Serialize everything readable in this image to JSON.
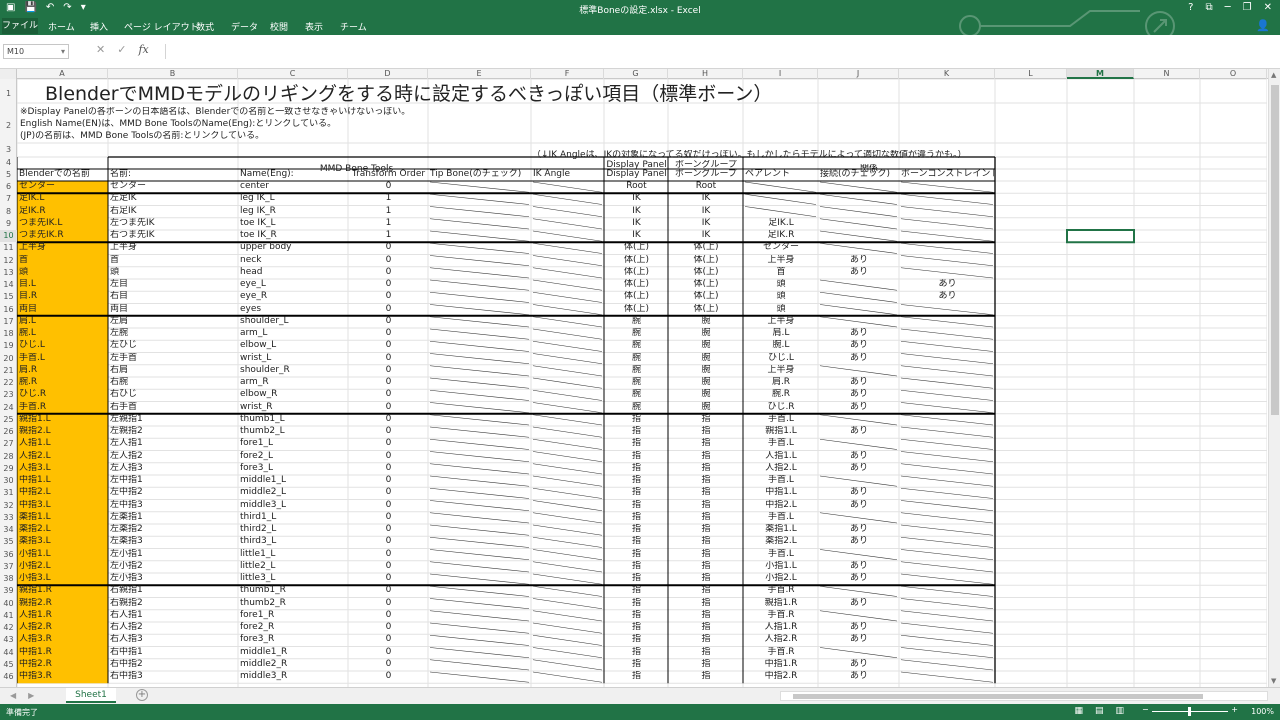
{
  "window": {
    "title": "標準Boneの設定.xlsx - Excel",
    "ribbon_tabs": [
      "ファイル",
      "ホーム",
      "挿入",
      "ページ レイアウト",
      "数式",
      "データ",
      "校閲",
      "表示",
      "チーム"
    ]
  },
  "formula_bar": {
    "name_box": "M10",
    "formula": ""
  },
  "columns": [
    "A",
    "B",
    "C",
    "D",
    "E",
    "F",
    "G",
    "H",
    "I",
    "J",
    "K",
    "L",
    "M",
    "N",
    "O"
  ],
  "selected_column": "M",
  "selected_cell": "M10",
  "sheet": {
    "title": "BlenderでMMDモデルのリギングをする時に設定するべきっぽい項目（標準ボーン）",
    "notes": [
      "※Display Panelの各ボーンの日本語名は、Blenderでの名前と一致させなきゃいけないっぽい。",
      "English Name(EN)は、MMD Bone ToolsのName(Eng):とリンクしている。",
      "(JP)の名前は、MMD Bone Toolsの名前:とリンクしている。"
    ],
    "ik_note": "（↓IK Angleは、IKの対象になってる奴だけっぽい。もしかしたらモデルによって適切な数値が違うかも。）",
    "group_headers": {
      "mmd": "MMD Bone Tools",
      "relation": "関係"
    },
    "headers": {
      "a": "Blenderでの名前",
      "b": "名前:",
      "c": "Name(Eng):",
      "d": "Transform Order",
      "e": "Tip Bone(のチェック)",
      "f": "IK Angle",
      "g": "Display Panel",
      "h": "ボーングループ",
      "i": "ペアレント",
      "j": "接続(のチェック)",
      "k": "ボーンコンストレイント"
    },
    "rows": [
      {
        "n": 6,
        "a": "センター",
        "b": "センター",
        "c": "center",
        "d": "0",
        "g": "Root",
        "h": "Root",
        "i": "",
        "j": "",
        "k": ""
      },
      {
        "n": 7,
        "a": "足IK.L",
        "b": "左足IK",
        "c": "leg IK_L",
        "d": "1",
        "g": "IK",
        "h": "IK",
        "i": "",
        "j": "",
        "k": ""
      },
      {
        "n": 8,
        "a": "足IK.R",
        "b": "右足IK",
        "c": "leg IK_R",
        "d": "1",
        "g": "IK",
        "h": "IK",
        "i": "",
        "j": "",
        "k": ""
      },
      {
        "n": 9,
        "a": "つま先IK.L",
        "b": "左つま先IK",
        "c": "toe IK_L",
        "d": "1",
        "g": "IK",
        "h": "IK",
        "i": "足IK.L",
        "j": "",
        "k": ""
      },
      {
        "n": 10,
        "a": "つま先IK.R",
        "b": "右つま先IK",
        "c": "toe IK_R",
        "d": "1",
        "g": "IK",
        "h": "IK",
        "i": "足IK.R",
        "j": "",
        "k": ""
      },
      {
        "n": 11,
        "a": "上半身",
        "b": "上半身",
        "c": "upper body",
        "d": "0",
        "g": "体(上)",
        "h": "体(上)",
        "i": "センター",
        "j": "",
        "k": ""
      },
      {
        "n": 12,
        "a": "首",
        "b": "首",
        "c": "neck",
        "d": "0",
        "g": "体(上)",
        "h": "体(上)",
        "i": "上半身",
        "j": "あり",
        "k": ""
      },
      {
        "n": 13,
        "a": "頭",
        "b": "頭",
        "c": "head",
        "d": "0",
        "g": "体(上)",
        "h": "体(上)",
        "i": "首",
        "j": "あり",
        "k": ""
      },
      {
        "n": 14,
        "a": "目.L",
        "b": "左目",
        "c": "eye_L",
        "d": "0",
        "g": "体(上)",
        "h": "体(上)",
        "i": "頭",
        "j": "",
        "k": "あり"
      },
      {
        "n": 15,
        "a": "目.R",
        "b": "右目",
        "c": "eye_R",
        "d": "0",
        "g": "体(上)",
        "h": "体(上)",
        "i": "頭",
        "j": "",
        "k": "あり"
      },
      {
        "n": 16,
        "a": "両目",
        "b": "両目",
        "c": "eyes",
        "d": "0",
        "g": "体(上)",
        "h": "体(上)",
        "i": "頭",
        "j": "",
        "k": ""
      },
      {
        "n": 17,
        "a": "肩.L",
        "b": "左肩",
        "c": "shoulder_L",
        "d": "0",
        "g": "腕",
        "h": "腕",
        "i": "上半身",
        "j": "",
        "k": ""
      },
      {
        "n": 18,
        "a": "腕.L",
        "b": "左腕",
        "c": "arm_L",
        "d": "0",
        "g": "腕",
        "h": "腕",
        "i": "肩.L",
        "j": "あり",
        "k": ""
      },
      {
        "n": 19,
        "a": "ひじ.L",
        "b": "左ひじ",
        "c": "elbow_L",
        "d": "0",
        "g": "腕",
        "h": "腕",
        "i": "腕.L",
        "j": "あり",
        "k": ""
      },
      {
        "n": 20,
        "a": "手首.L",
        "b": "左手首",
        "c": "wrist_L",
        "d": "0",
        "g": "腕",
        "h": "腕",
        "i": "ひじ.L",
        "j": "あり",
        "k": ""
      },
      {
        "n": 21,
        "a": "肩.R",
        "b": "右肩",
        "c": "shoulder_R",
        "d": "0",
        "g": "腕",
        "h": "腕",
        "i": "上半身",
        "j": "",
        "k": ""
      },
      {
        "n": 22,
        "a": "腕.R",
        "b": "右腕",
        "c": "arm_R",
        "d": "0",
        "g": "腕",
        "h": "腕",
        "i": "肩.R",
        "j": "あり",
        "k": ""
      },
      {
        "n": 23,
        "a": "ひじ.R",
        "b": "右ひじ",
        "c": "elbow_R",
        "d": "0",
        "g": "腕",
        "h": "腕",
        "i": "腕.R",
        "j": "あり",
        "k": ""
      },
      {
        "n": 24,
        "a": "手首.R",
        "b": "右手首",
        "c": "wrist_R",
        "d": "0",
        "g": "腕",
        "h": "腕",
        "i": "ひじ.R",
        "j": "あり",
        "k": ""
      },
      {
        "n": 25,
        "a": "親指1.L",
        "b": "左親指1",
        "c": "thumb1_L",
        "d": "0",
        "g": "指",
        "h": "指",
        "i": "手首.L",
        "j": "",
        "k": ""
      },
      {
        "n": 26,
        "a": "親指2.L",
        "b": "左親指2",
        "c": "thumb2_L",
        "d": "0",
        "g": "指",
        "h": "指",
        "i": "親指1.L",
        "j": "あり",
        "k": ""
      },
      {
        "n": 27,
        "a": "人指1.L",
        "b": "左人指1",
        "c": "fore1_L",
        "d": "0",
        "g": "指",
        "h": "指",
        "i": "手首.L",
        "j": "",
        "k": ""
      },
      {
        "n": 28,
        "a": "人指2.L",
        "b": "左人指2",
        "c": "fore2_L",
        "d": "0",
        "g": "指",
        "h": "指",
        "i": "人指1.L",
        "j": "あり",
        "k": ""
      },
      {
        "n": 29,
        "a": "人指3.L",
        "b": "左人指3",
        "c": "fore3_L",
        "d": "0",
        "g": "指",
        "h": "指",
        "i": "人指2.L",
        "j": "あり",
        "k": ""
      },
      {
        "n": 30,
        "a": "中指1.L",
        "b": "左中指1",
        "c": "middle1_L",
        "d": "0",
        "g": "指",
        "h": "指",
        "i": "手首.L",
        "j": "",
        "k": ""
      },
      {
        "n": 31,
        "a": "中指2.L",
        "b": "左中指2",
        "c": "middle2_L",
        "d": "0",
        "g": "指",
        "h": "指",
        "i": "中指1.L",
        "j": "あり",
        "k": ""
      },
      {
        "n": 32,
        "a": "中指3.L",
        "b": "左中指3",
        "c": "middle3_L",
        "d": "0",
        "g": "指",
        "h": "指",
        "i": "中指2.L",
        "j": "あり",
        "k": ""
      },
      {
        "n": 33,
        "a": "薬指1.L",
        "b": "左薬指1",
        "c": "third1_L",
        "d": "0",
        "g": "指",
        "h": "指",
        "i": "手首.L",
        "j": "",
        "k": ""
      },
      {
        "n": 34,
        "a": "薬指2.L",
        "b": "左薬指2",
        "c": "third2_L",
        "d": "0",
        "g": "指",
        "h": "指",
        "i": "薬指1.L",
        "j": "あり",
        "k": ""
      },
      {
        "n": 35,
        "a": "薬指3.L",
        "b": "左薬指3",
        "c": "third3_L",
        "d": "0",
        "g": "指",
        "h": "指",
        "i": "薬指2.L",
        "j": "あり",
        "k": ""
      },
      {
        "n": 36,
        "a": "小指1.L",
        "b": "左小指1",
        "c": "little1_L",
        "d": "0",
        "g": "指",
        "h": "指",
        "i": "手首.L",
        "j": "",
        "k": ""
      },
      {
        "n": 37,
        "a": "小指2.L",
        "b": "左小指2",
        "c": "little2_L",
        "d": "0",
        "g": "指",
        "h": "指",
        "i": "小指1.L",
        "j": "あり",
        "k": ""
      },
      {
        "n": 38,
        "a": "小指3.L",
        "b": "左小指3",
        "c": "little3_L",
        "d": "0",
        "g": "指",
        "h": "指",
        "i": "小指2.L",
        "j": "あり",
        "k": ""
      },
      {
        "n": 39,
        "a": "親指1.R",
        "b": "右親指1",
        "c": "thumb1_R",
        "d": "0",
        "g": "指",
        "h": "指",
        "i": "手首.R",
        "j": "",
        "k": ""
      },
      {
        "n": 40,
        "a": "親指2.R",
        "b": "右親指2",
        "c": "thumb2_R",
        "d": "0",
        "g": "指",
        "h": "指",
        "i": "親指1.R",
        "j": "あり",
        "k": ""
      },
      {
        "n": 41,
        "a": "人指1.R",
        "b": "右人指1",
        "c": "fore1_R",
        "d": "0",
        "g": "指",
        "h": "指",
        "i": "手首.R",
        "j": "",
        "k": ""
      },
      {
        "n": 42,
        "a": "人指2.R",
        "b": "右人指2",
        "c": "fore2_R",
        "d": "0",
        "g": "指",
        "h": "指",
        "i": "人指1.R",
        "j": "あり",
        "k": ""
      },
      {
        "n": 43,
        "a": "人指3.R",
        "b": "右人指3",
        "c": "fore3_R",
        "d": "0",
        "g": "指",
        "h": "指",
        "i": "人指2.R",
        "j": "あり",
        "k": ""
      },
      {
        "n": 44,
        "a": "中指1.R",
        "b": "右中指1",
        "c": "middle1_R",
        "d": "0",
        "g": "指",
        "h": "指",
        "i": "手首.R",
        "j": "",
        "k": ""
      },
      {
        "n": 45,
        "a": "中指2.R",
        "b": "右中指2",
        "c": "middle2_R",
        "d": "0",
        "g": "指",
        "h": "指",
        "i": "中指1.R",
        "j": "あり",
        "k": ""
      },
      {
        "n": 46,
        "a": "中指3.R",
        "b": "右中指3",
        "c": "middle3_R",
        "d": "0",
        "g": "指",
        "h": "指",
        "i": "中指2.R",
        "j": "あり",
        "k": ""
      }
    ]
  },
  "sheet_tabs": [
    "Sheet1"
  ],
  "status": {
    "text": "準備完了",
    "zoom": "100%"
  },
  "colors": {
    "excel_green": "#217346",
    "highlight_orange": "#ffc000"
  }
}
